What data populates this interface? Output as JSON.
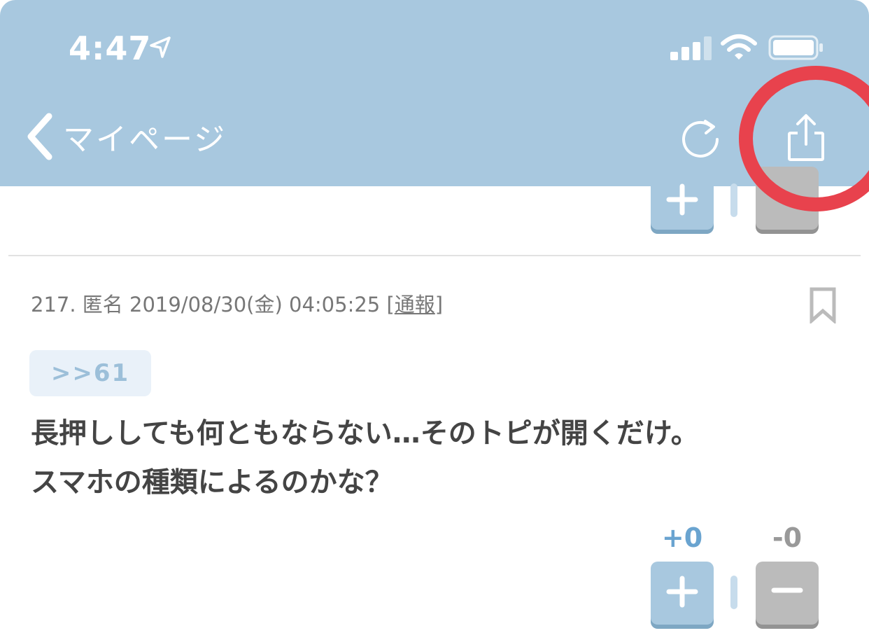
{
  "status_bar": {
    "time": "4:47",
    "location_icon": "location-arrow-icon",
    "signal_icon": "cellular-signal-icon",
    "wifi_icon": "wifi-icon",
    "battery_icon": "battery-icon"
  },
  "nav": {
    "back_label": "マイページ",
    "back_icon": "chevron-left-icon",
    "refresh_icon": "refresh-icon",
    "share_icon": "share-icon",
    "highlight_color": "#e8424d"
  },
  "post": {
    "meta_prefix": "217. 匿名 2019/08/30(金) 04:05:25 [",
    "report_label": "通報",
    "meta_suffix": "]",
    "bookmark_icon": "bookmark-icon",
    "anchor": ">>61",
    "body_lines": [
      "長押ししても何ともならない…そのトピが開くだけ。",
      "スマホの種類によるのかな？"
    ],
    "plus_count": "+0",
    "minus_count": "-0"
  },
  "colors": {
    "header_bg": "#a8c8df",
    "plus_button": "#a8c8df",
    "minus_button": "#bbbbbb",
    "plus_count": "#6aa4d0"
  }
}
